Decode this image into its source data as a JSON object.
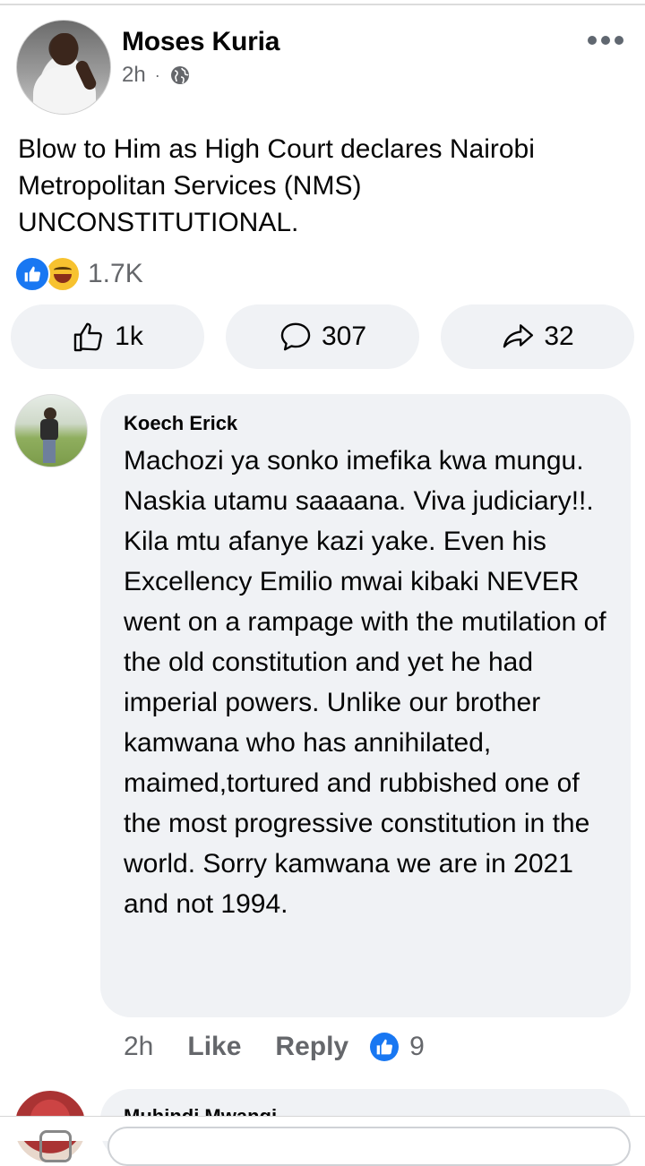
{
  "post": {
    "author": "Moses Kuria",
    "time": "2h",
    "separator": "·",
    "visibility_icon": "globe-icon",
    "more_icon": "more-options-icon",
    "text": "Blow to Him as High Court declares Nairobi Metropolitan Services (NMS) UNCONSTITUTIONAL.",
    "reaction_icons": [
      "like-reaction-icon",
      "haha-reaction-icon"
    ],
    "reaction_count": "1.7K",
    "actions": {
      "like_count": "1k",
      "comment_count": "307",
      "share_count": "32"
    }
  },
  "comments": [
    {
      "name": "Koech Erick",
      "text": "Machozi ya sonko imefika kwa mungu. Naskia utamu saaaana. Viva judiciary!!. Kila mtu afanye kazi yake. Even his Excellency Emilio mwai kibaki NEVER went on a rampage with the mutilation of the old constitution and yet he had imperial powers. Unlike our brother kamwana who has annihilated, maimed,tortured and rubbished one of the most progressive constitution in the world. Sorry kamwana we are in 2021 and not 1994.",
      "time": "2h",
      "like_label": "Like",
      "reply_label": "Reply",
      "like_count": "9"
    },
    {
      "name": "Muhindi Mwangi"
    }
  ],
  "colors": {
    "accent": "#1877f2",
    "secondary_text": "#65676b",
    "bubble": "#f0f2f5"
  }
}
